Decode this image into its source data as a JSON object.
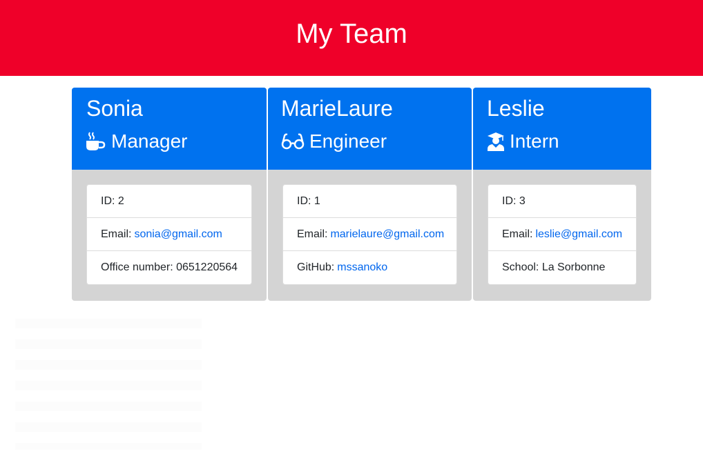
{
  "header": {
    "title": "My Team"
  },
  "colors": {
    "header_bg": "#ef0029",
    "card_header_bg": "#0072ef",
    "card_body_bg": "#d4d4d4",
    "link": "#0066ee"
  },
  "cards": [
    {
      "name": "Sonia",
      "role": "Manager",
      "role_icon": "coffee-icon",
      "id_text": "ID: 2",
      "email_label": "Email:",
      "email": "sonia@gmail.com",
      "extra_label": "Office number: 0651220564",
      "extra_link": ""
    },
    {
      "name": "MarieLaure",
      "role": "Engineer",
      "role_icon": "glasses-icon",
      "id_text": "ID: 1",
      "email_label": "Email:",
      "email": "marielaure@gmail.com",
      "extra_label": "GitHub:",
      "extra_link": "mssanoko"
    },
    {
      "name": "Leslie",
      "role": "Intern",
      "role_icon": "graduate-icon",
      "id_text": "ID: 3",
      "email_label": "Email:",
      "email": "leslie@gmail.com",
      "extra_label": "School: La Sorbonne",
      "extra_link": ""
    }
  ]
}
